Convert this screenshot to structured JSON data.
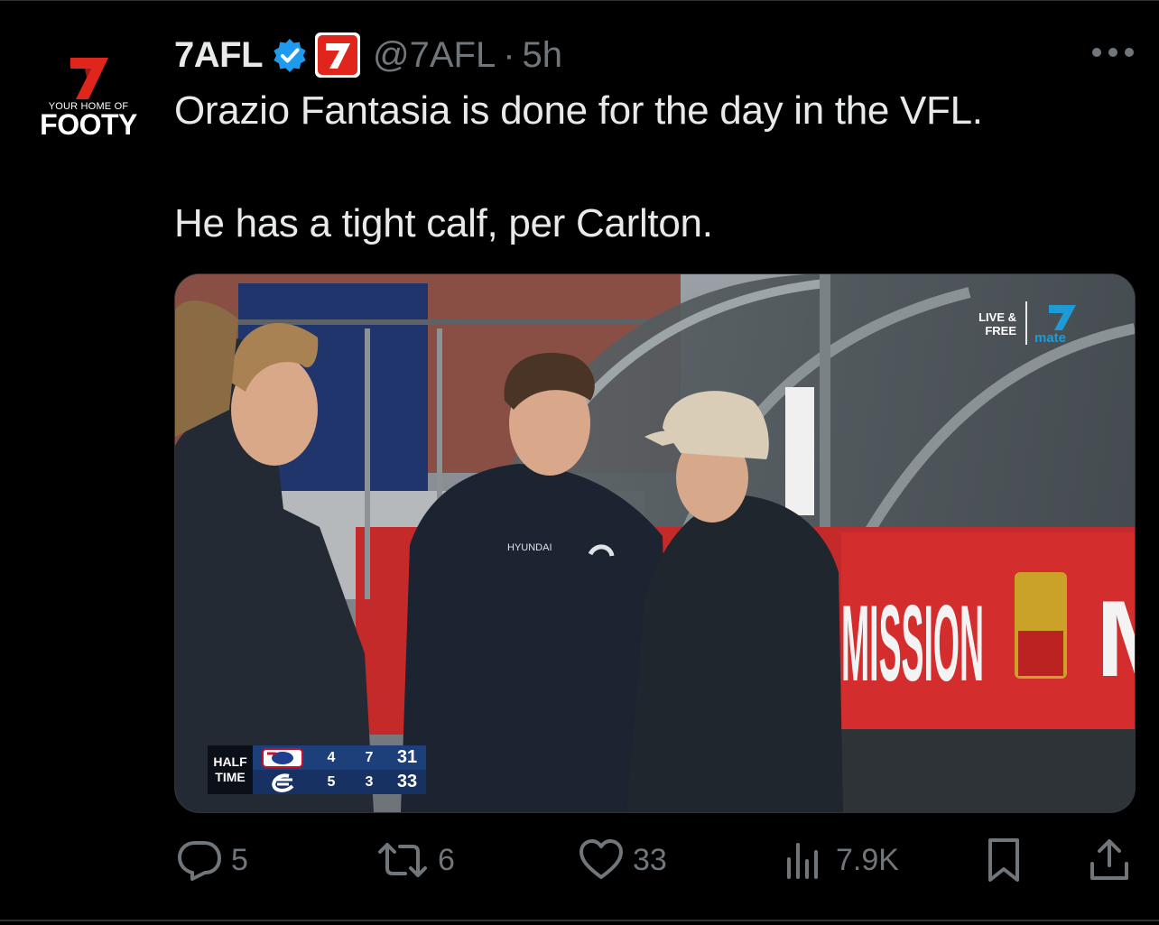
{
  "tweet": {
    "avatar": {
      "tagline": "YOUR HOME OF",
      "wordmark": "FOOTY",
      "icon": "channel-7-logo",
      "accent": "#e0261c"
    },
    "author": {
      "name": "7AFL",
      "handle": "@7AFL",
      "separator": "·",
      "time": "5h",
      "verified_icon": "verified-badge-icon",
      "verified_color": "#1d9bf0",
      "affiliate_icon": "channel-7-affiliate-badge"
    },
    "text_line1": "Orazio Fantasia is done for the day in the VFL.",
    "text_line2": "He has a tight calf, per Carlton.",
    "media": {
      "broadcast": {
        "live_line1": "LIVE &",
        "live_line2": "FREE",
        "channel": "mate",
        "channel_icon": "7mate-logo"
      },
      "signage": {
        "banner": "MISSION",
        "banner_edge": "M"
      },
      "scorebug": {
        "period_line1": "HALF",
        "period_line2": "TIME",
        "teams": [
          {
            "logo": "western-bulldogs-logo",
            "goals": "4",
            "behinds": "7",
            "total": "31"
          },
          {
            "logo": "carlton-logo",
            "goals": "5",
            "behinds": "3",
            "total": "33"
          }
        ]
      }
    },
    "stats": {
      "replies": "5",
      "reposts": "6",
      "likes": "33",
      "views": "7.9K"
    }
  },
  "colors": {
    "background": "#000000",
    "text": "#e7e9ea",
    "muted": "#71767b",
    "border": "#2f3336"
  }
}
